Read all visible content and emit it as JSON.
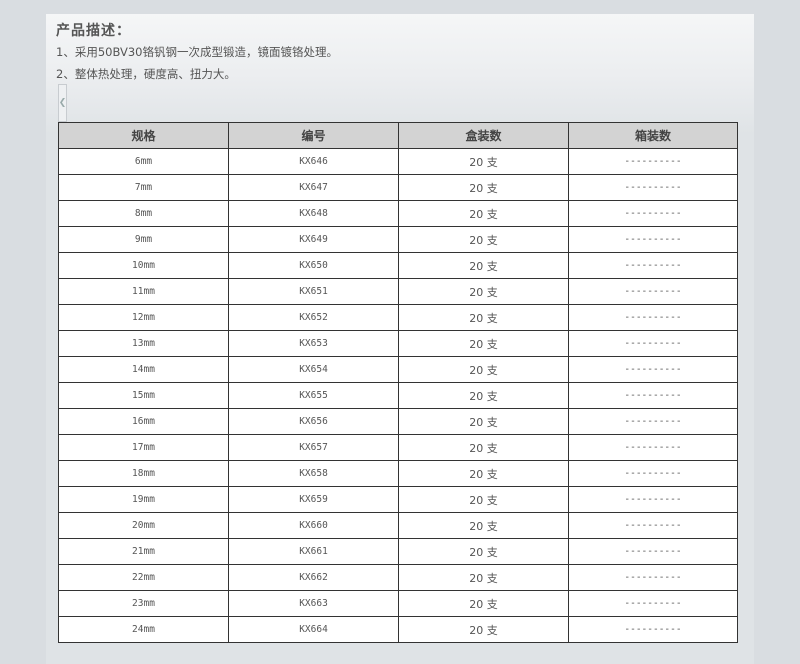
{
  "description": {
    "title": "产品描述：",
    "lines": [
      "1、采用50BV30铬钒钢一次成型锻造，镜面镀铬处理。",
      "2、整体热处理，硬度高、扭力大。"
    ]
  },
  "table": {
    "headers": [
      "规格",
      "编号",
      "盒装数",
      "箱装数"
    ],
    "rows": [
      [
        "6mm",
        "KX646",
        "20 支",
        "----------"
      ],
      [
        "7mm",
        "KX647",
        "20 支",
        "----------"
      ],
      [
        "8mm",
        "KX648",
        "20 支",
        "----------"
      ],
      [
        "9mm",
        "KX649",
        "20 支",
        "----------"
      ],
      [
        "10mm",
        "KX650",
        "20 支",
        "----------"
      ],
      [
        "11mm",
        "KX651",
        "20 支",
        "----------"
      ],
      [
        "12mm",
        "KX652",
        "20 支",
        "----------"
      ],
      [
        "13mm",
        "KX653",
        "20 支",
        "----------"
      ],
      [
        "14mm",
        "KX654",
        "20 支",
        "----------"
      ],
      [
        "15mm",
        "KX655",
        "20 支",
        "----------"
      ],
      [
        "16mm",
        "KX656",
        "20 支",
        "----------"
      ],
      [
        "17mm",
        "KX657",
        "20 支",
        "----------"
      ],
      [
        "18mm",
        "KX658",
        "20 支",
        "----------"
      ],
      [
        "19mm",
        "KX659",
        "20 支",
        "----------"
      ],
      [
        "20mm",
        "KX660",
        "20 支",
        "----------"
      ],
      [
        "21mm",
        "KX661",
        "20 支",
        "----------"
      ],
      [
        "22mm",
        "KX662",
        "20 支",
        "----------"
      ],
      [
        "23mm",
        "KX663",
        "20 支",
        "----------"
      ],
      [
        "24mm",
        "KX664",
        "20 支",
        "----------"
      ]
    ]
  },
  "icons": {
    "collapse_tab": "chevron-left-icon"
  }
}
